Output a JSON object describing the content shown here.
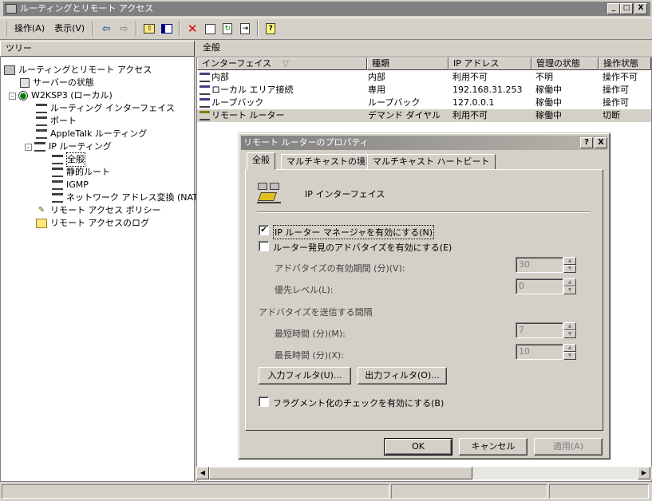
{
  "window": {
    "title": "ルーティングとリモート アクセス",
    "min": "_",
    "max": "□",
    "close": "X"
  },
  "menu": {
    "action": "操作(A)",
    "view": "表示(V)"
  },
  "tree": {
    "header": "ツリー",
    "items": [
      {
        "label": "ルーティングとリモート アクセス"
      },
      {
        "label": "サーバーの状態"
      },
      {
        "label": "W2KSP3 (ローカル)"
      },
      {
        "label": "ルーティング インターフェイス"
      },
      {
        "label": "ポート"
      },
      {
        "label": "AppleTalk ルーティング"
      },
      {
        "label": "IP ルーティング"
      },
      {
        "label": "全般"
      },
      {
        "label": "静的ルート"
      },
      {
        "label": "IGMP"
      },
      {
        "label": "ネットワーク アドレス変換 (NAT)"
      },
      {
        "label": "リモート アクセス ポリシー"
      },
      {
        "label": "リモート アクセスのログ"
      }
    ]
  },
  "list": {
    "pane_title": "全般",
    "columns": [
      "インターフェイス",
      "種類",
      "IP アドレス",
      "管理の状態",
      "操作状態"
    ],
    "sort_indicator": "▽",
    "rows": [
      [
        "内部",
        "内部",
        "利用不可",
        "不明",
        "操作不可"
      ],
      [
        "ローカル エリア接続",
        "専用",
        "192.168.31.253",
        "稼働中",
        "操作可"
      ],
      [
        "ループバック",
        "ループバック",
        "127.0.0.1",
        "稼働中",
        "操作可"
      ],
      [
        "リモート ルーター",
        "デマンド ダイヤル",
        "利用不可",
        "稼働中",
        "切断"
      ]
    ]
  },
  "dialog": {
    "title": "リモート ルーターのプロパティ",
    "help": "?",
    "close": "X",
    "tabs": [
      "全般",
      "マルチキャストの境界",
      "マルチキャスト ハートビート"
    ],
    "section_title": "IP インターフェイス",
    "chk_router_manager": "IP ルーター マネージャを有効にする(N)",
    "chk_router_manager_checked": "✔",
    "chk_discovery": "ルーター発見のアドバタイズを有効にする(E)",
    "adv_lifetime_label": "アドバタイズの有効期間 (分)(V):",
    "adv_lifetime_value": "30",
    "preference_label": "優先レベル(L):",
    "preference_value": "0",
    "interval_heading": "アドバタイズを送信する間隔",
    "min_label": "最短時間 (分)(M):",
    "min_value": "7",
    "max_label": "最長時間 (分)(X):",
    "max_value": "10",
    "input_filter": "入力フィルタ(U)...",
    "output_filter": "出力フィルタ(O)...",
    "chk_fragment": "フラグメント化のチェックを有効にする(B)",
    "ok": "OK",
    "cancel": "キャンセル",
    "apply": "適用(A)"
  }
}
